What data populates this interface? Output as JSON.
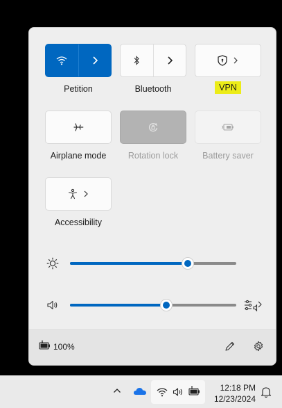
{
  "tiles": {
    "wifi": {
      "label": "Petition",
      "state": "on"
    },
    "bluetooth": {
      "label": "Bluetooth",
      "state": "off"
    },
    "vpn": {
      "label": "VPN",
      "highlight": "#ecec18"
    },
    "airplane": {
      "label": "Airplane mode",
      "state": "off"
    },
    "rotation": {
      "label": "Rotation lock",
      "state": "disabled"
    },
    "battery_saver": {
      "label": "Battery saver",
      "state": "disabled"
    },
    "accessibility": {
      "label": "Accessibility"
    }
  },
  "sliders": {
    "brightness": {
      "value_fraction": 0.71,
      "icon": "sun-icon"
    },
    "volume": {
      "value_fraction": 0.58,
      "icon": "speaker-icon"
    }
  },
  "footer": {
    "battery": "100%",
    "battery_icon": "battery-charging-icon"
  },
  "taskbar": {
    "time": "12:18 PM",
    "date": "12/23/2024",
    "icons": [
      "chevron-up-icon",
      "onedrive-cloud-icon",
      "wifi-icon",
      "speaker-icon",
      "battery-icon",
      "bell-icon"
    ]
  },
  "colors": {
    "accent": "#0067c0",
    "panel": "#eeeeee",
    "taskbar": "#eaeaea"
  }
}
